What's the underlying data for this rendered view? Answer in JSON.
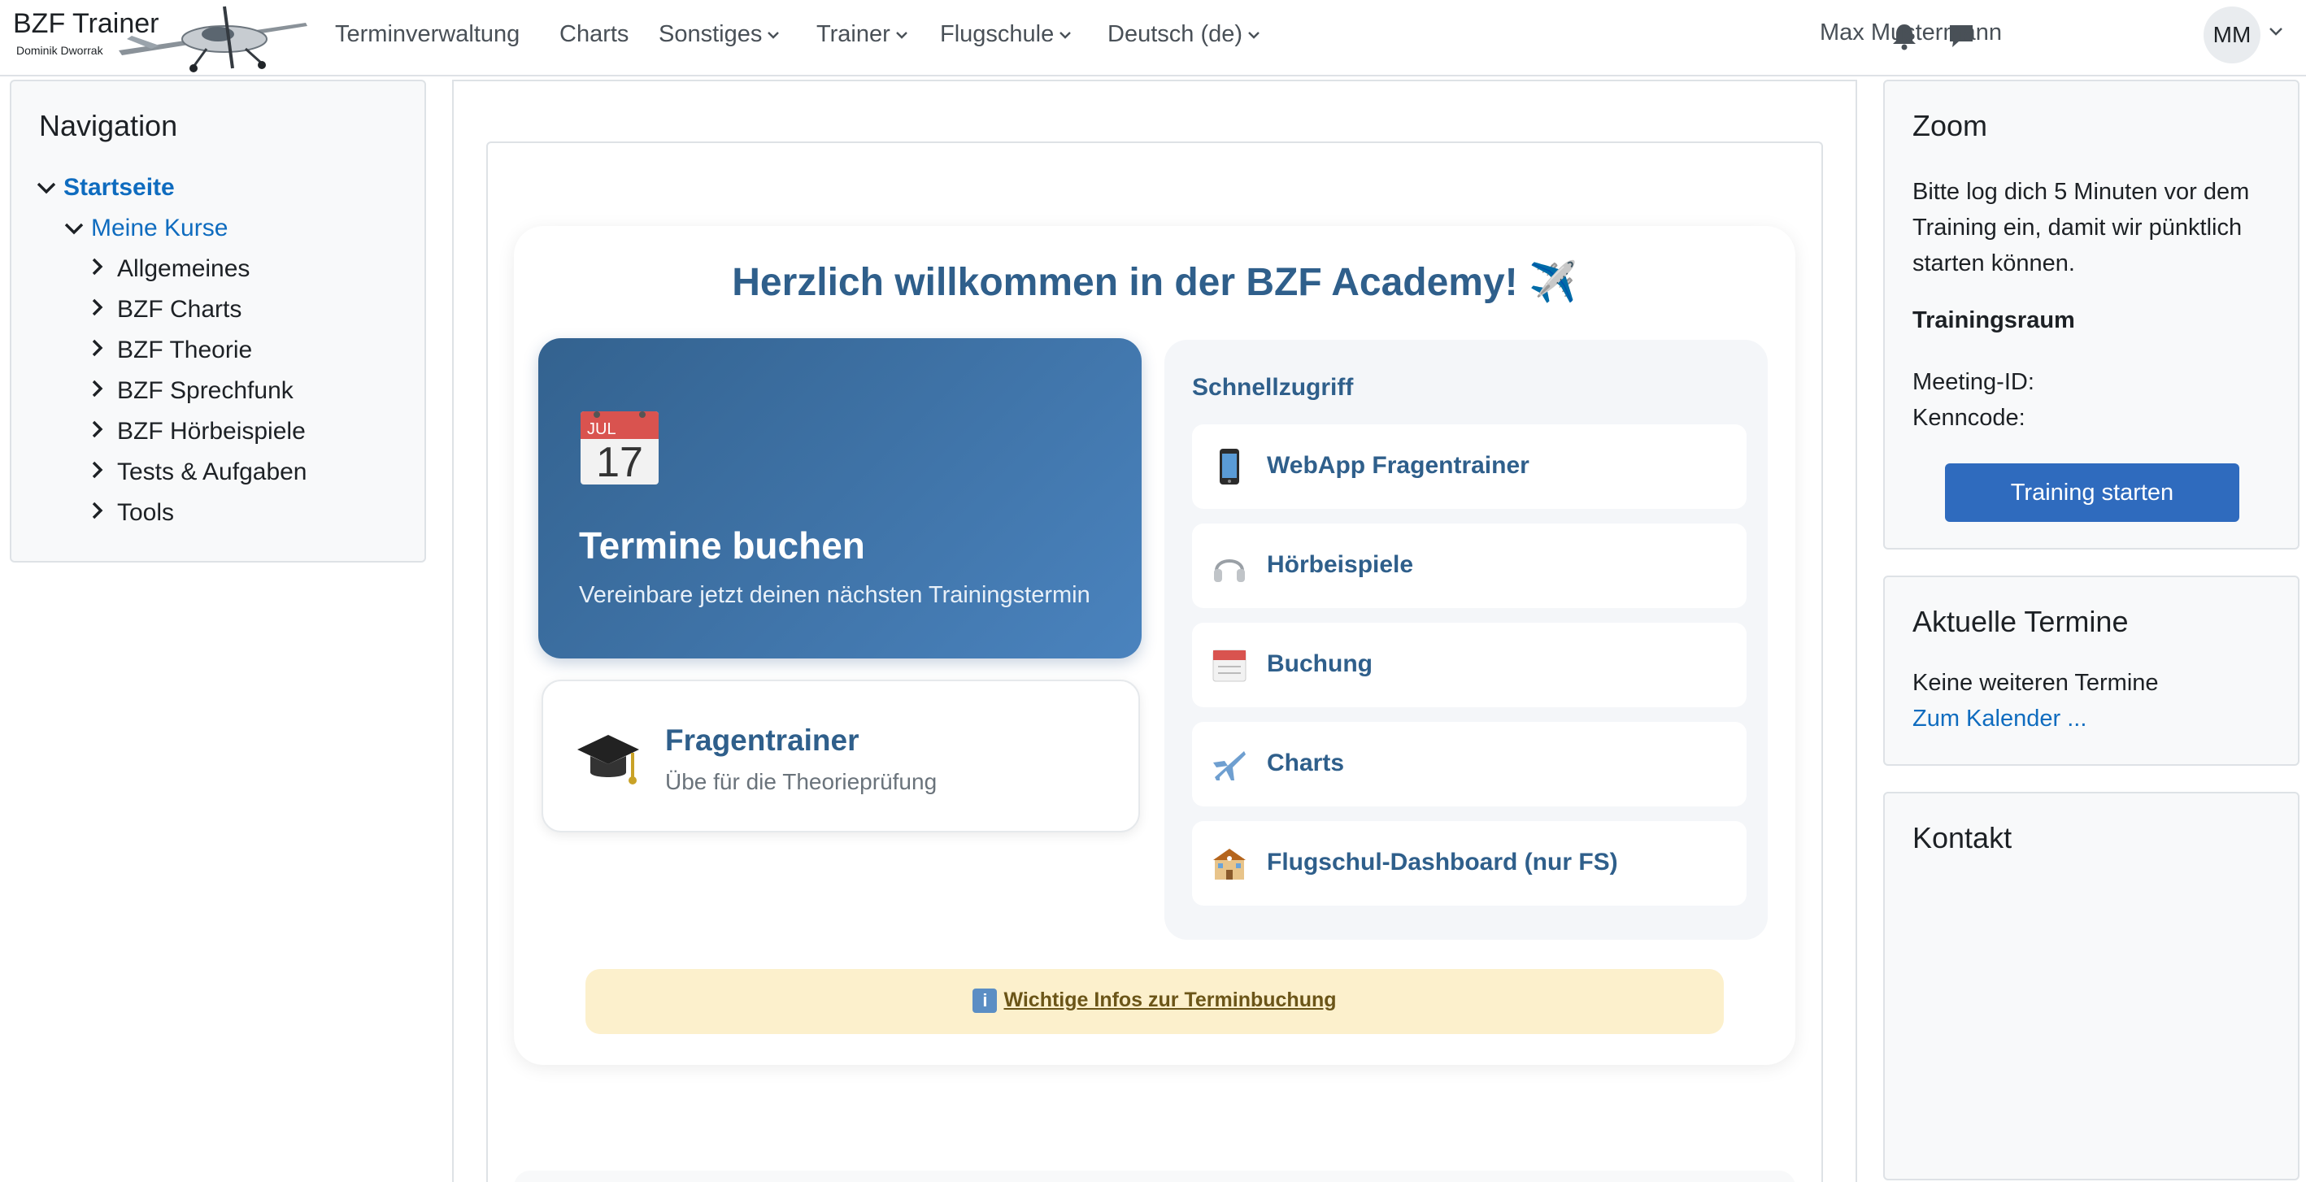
{
  "header": {
    "brand_title": "BZF Trainer",
    "brand_subtitle": "Dominik Dworrak",
    "nav": [
      {
        "label": "Terminverwaltung"
      },
      {
        "label": "Charts"
      },
      {
        "label": "Sonstiges"
      },
      {
        "label": "Trainer"
      },
      {
        "label": "Flugschule"
      },
      {
        "label": "Deutsch ‎(de)‎"
      }
    ],
    "user_name": "Max Mustermann",
    "user_initials": "MM"
  },
  "navigation": {
    "title": "Navigation",
    "home": "Startseite",
    "my_courses": "Meine Kurse",
    "courses": [
      {
        "label": "Allgemeines"
      },
      {
        "label": "BZF Charts"
      },
      {
        "label": "BZF Theorie"
      },
      {
        "label": "BZF Sprechfunk"
      },
      {
        "label": "BZF Hörbeispiele"
      },
      {
        "label": "Tests & Aufgaben"
      },
      {
        "label": "Tools"
      }
    ]
  },
  "main": {
    "welcome": "Herzlich willkommen in der BZF Academy! ✈️",
    "booking_card": {
      "calendar_month": "JUL",
      "calendar_day": "17",
      "title": "Termine buchen",
      "subtitle": "Vereinbare jetzt deinen nächsten Trainingstermin"
    },
    "trainer_card": {
      "title": "Fragentrainer",
      "subtitle": "Übe für die Theorieprüfung"
    },
    "quick_access": {
      "title": "Schnellzugriff",
      "items": [
        {
          "label": "WebApp Fragentrainer",
          "icon": "mobile-phone-icon"
        },
        {
          "label": "Hörbeispiele",
          "icon": "headphones-icon"
        },
        {
          "label": "Buchung",
          "icon": "calendar-icon"
        },
        {
          "label": "Charts",
          "icon": "airplane-icon"
        },
        {
          "label": "Flugschul-Dashboard (nur FS)",
          "icon": "school-building-icon"
        }
      ]
    },
    "info_link": "Wichtige Infos zur Terminbuchung",
    "info_icon": "i"
  },
  "zoom": {
    "title": "Zoom",
    "text": "Bitte log dich 5 Minuten vor dem Training ein, damit wir pünktlich starten können.",
    "room_label": "Trainingsraum",
    "meeting_id_label": "Meeting-ID:",
    "passcode_label": "Kenncode:",
    "button": "Training starten"
  },
  "events": {
    "title": "Aktuelle Termine",
    "empty": "Keine weiteren Termine",
    "calendar_link": "Zum Kalender ..."
  },
  "contact": {
    "title": "Kontakt"
  },
  "colors": {
    "accent": "#2f5f8b",
    "link": "#0f6cbf",
    "button": "#2f6bbe",
    "info_bg": "#fcf0cc"
  }
}
